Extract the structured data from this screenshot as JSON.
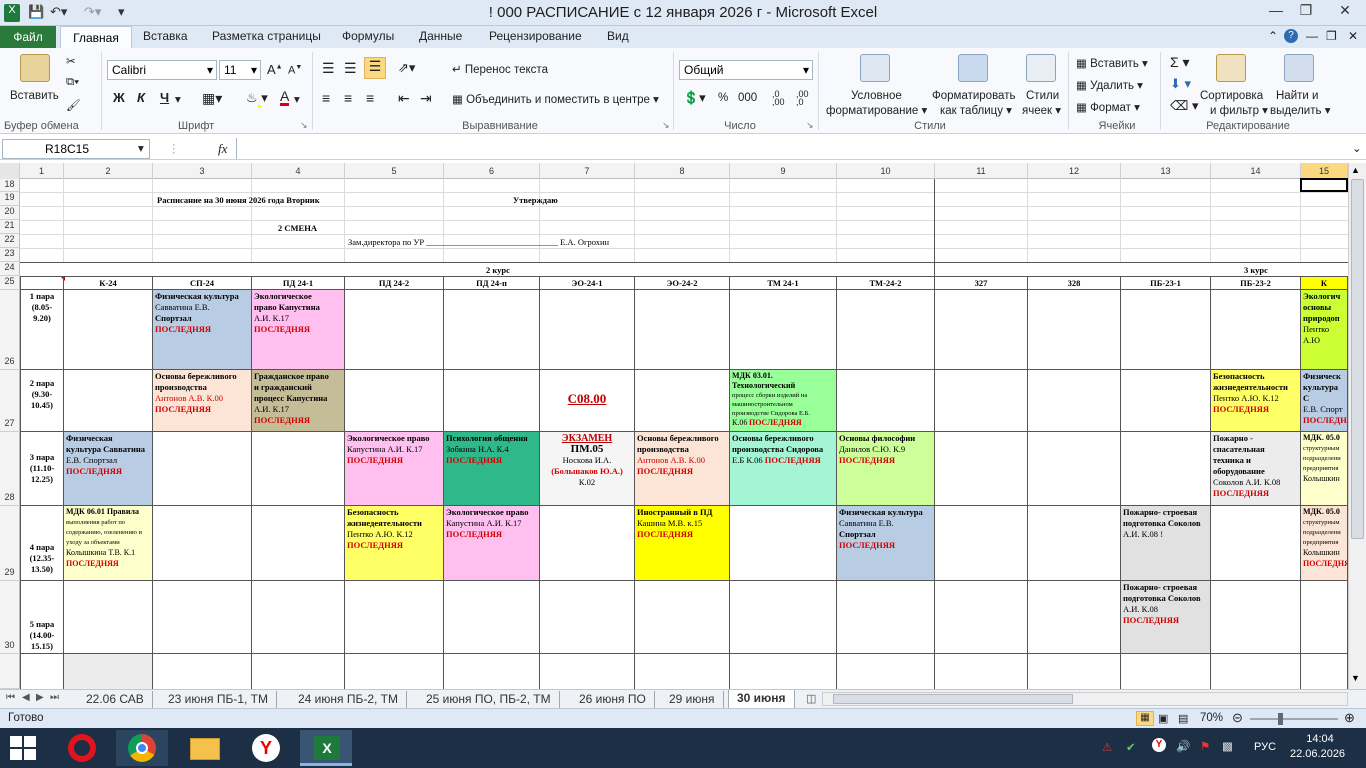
{
  "window": {
    "title": "! 000 РАСПИСАНИЕ с 12 января 2026 г  -  Microsoft Excel"
  },
  "tabs": [
    "Файл",
    "Главная",
    "Вставка",
    "Разметка страницы",
    "Формулы",
    "Данные",
    "Рецензирование",
    "Вид"
  ],
  "ribbon": {
    "clipboard": {
      "paste": "Вставить",
      "label": "Буфер обмена"
    },
    "font": {
      "name": "Calibri",
      "size": "11",
      "label": "Шрифт",
      "bold": "Ж",
      "italic": "К",
      "underline": "Ч"
    },
    "alignment": {
      "wrap": "Перенос текста",
      "merge": "Объединить и поместить в центре",
      "label": "Выравнивание"
    },
    "number": {
      "format": "Общий",
      "label": "Число"
    },
    "styles": {
      "cond": "Условное",
      "cond2": "форматирование",
      "table": "Форматировать",
      "table2": "как таблицу",
      "cell": "Стили",
      "cell2": "ячеек",
      "label": "Стили"
    },
    "cells": {
      "insert": "Вставить",
      "delete": "Удалить",
      "format": "Формат",
      "label": "Ячейки"
    },
    "editing": {
      "sort": "Сортировка",
      "sort2": "и фильтр",
      "find": "Найти и",
      "find2": "выделить",
      "label": "Редактирование"
    }
  },
  "formula": {
    "namebox": "R18C15",
    "fx": "fx",
    "content": ""
  },
  "columns": [
    "1",
    "2",
    "3",
    "4",
    "5",
    "6",
    "7",
    "8",
    "9",
    "10",
    "11",
    "12",
    "13",
    "14",
    "15"
  ],
  "rows": [
    "18",
    "19",
    "20",
    "21",
    "22",
    "23",
    "24",
    "25",
    "26",
    "27",
    "28",
    "29",
    "30"
  ],
  "sheet": {
    "heading": "Расписание на 30 июня 2026 года  Вторник",
    "approve": "Утверждаю",
    "shift": "2 СМЕНА",
    "deputy": "Зам.директора по УР  _______________________________  Е.А. Огрохин",
    "course2": "2 курс",
    "course3": "3 курс",
    "groups": [
      "К-24",
      "СП-24",
      "ПД 24-1",
      "ПД 24-2",
      "ПД 24-п",
      "ЭО-24-1",
      "ЭО-24-2",
      "ТМ 24-1",
      "ТМ-24-2",
      "327",
      "328",
      "ПБ-23-1",
      "ПБ-23-2",
      "К"
    ],
    "pairs": [
      {
        "n": "1 пара",
        "t": "(8.05-",
        "t2": "9.20)"
      },
      {
        "n": "2 пара",
        "t": "(9.30-",
        "t2": "10.45)"
      },
      {
        "n": "3 пара",
        "t": "(11.10-",
        "t2": "12.25)"
      },
      {
        "n": "4 пара",
        "t": "(12.35-",
        "t2": "13.50)"
      },
      {
        "n": "5 пара",
        "t": "(14.00-",
        "t2": "15.15)"
      }
    ],
    "last": "ПОСЛЕДНЯЯ",
    "cells": {
      "r1c3": {
        "a": "Физическая культура",
        "b": "Савватина Е.В.",
        "c": "Спортзал"
      },
      "r1c4": {
        "a": "Экологическое",
        "b": "право Капустина",
        "c": "А.И. К.17"
      },
      "r1c15": {
        "a": "Экологич",
        "b": "основы",
        "c": "природоп",
        "d": "Пентко А.Ю"
      },
      "r2c3": {
        "a": "Основы бережливого",
        "b": "производства",
        "c": "Антонов А.В. К.00"
      },
      "r2c4": {
        "a": "Гражданское право",
        "b": "и гражданский",
        "c": "процесс Капустина",
        "d": "А.И. К.17"
      },
      "r2c7": "С08.00",
      "r2c9": {
        "a": "МДК 03.01. Технологический",
        "b": "процесс сборки изделий на",
        "c": "машиностроительном",
        "d": "производстве Сидорова Е.Б.",
        "e": "К.06"
      },
      "r2c14": {
        "a": "Безопасность",
        "b": "жизнедеятельности",
        "c": "Пентко А.Ю. К.12"
      },
      "r2c15": {
        "a": "Физическ",
        "b": "культура С",
        "c": "Е.В. Спорт"
      },
      "r3c2": {
        "a": "Физическая",
        "b": "культура Савватина",
        "c": "Е.В. Спортзал"
      },
      "r3c5": {
        "a": "Экологическое право",
        "b": "Капустина А.И. К.17"
      },
      "r3c6": {
        "a": "Психология общения",
        "b": "Зобкина Н.А. К.4"
      },
      "r3c7": {
        "a": "ЭКЗАМЕН",
        "b": "ПМ.05",
        "c": "Носкова И.А.",
        "d": "(Большаков Ю.А.)",
        "e": "К.02"
      },
      "r3c8": {
        "a": "Основы бережливого",
        "b": "производства",
        "c": "Антонов А.В. К.00"
      },
      "r3c9": {
        "a": "Основы бережливого",
        "b": "производства Сидорова",
        "c": "Е.Б К.06"
      },
      "r3c10": {
        "a": "Основы философии",
        "b": "Данилов С.Ю. К.9"
      },
      "r3c14": {
        "a": "Пожарно -",
        "b": "спасательная",
        "c": "техника и",
        "d": "оборудование",
        "e": "Соколов А.И. К.08"
      },
      "r3c15": {
        "a": "МДК. 05.0",
        "b": "структурным",
        "c": "подразделени",
        "d": "предприятия",
        "e": "Колышкин"
      },
      "r4c2": {
        "a": "МДК 06.01 Правила",
        "b": "выполнения работ по",
        "c": "содержанию, озеленению и",
        "d": "уходу за объектами",
        "e": "Колышкина Т.В. К.1"
      },
      "r4c5": {
        "a": "Безопасность",
        "b": "жизнедеятельности",
        "c": "Пентко А.Ю. К.12"
      },
      "r4c6": {
        "a": "Экологическое право",
        "b": "Капустина А.И. К.17"
      },
      "r4c8": {
        "a": "Иностранный в ПД",
        "b": "Кашина М.В. к.15"
      },
      "r4c10": {
        "a": "Физическая культура",
        "b": "Савватина Е.В.",
        "c": "Спортзал"
      },
      "r4c13": {
        "a": "Пожарно- строевая",
        "b": "подготовка Соколов",
        "c": "А.И. К.08",
        "d": "!"
      },
      "r4c15": {
        "a": "МДК. 05.0",
        "b": "структурным",
        "c": "подразделени",
        "d": "предприятия",
        "e": "Колышкин"
      },
      "r5c13": {
        "a": "Пожарно- строевая",
        "b": "подготовка Соколов",
        "c": "А.И. К.08"
      }
    }
  },
  "sheet_tabs": [
    "22.06 САВ",
    "23 июня ПБ-1, ТМ",
    "24 июня ПБ-2, ТМ",
    "25 июня ПО, ПБ-2, ТМ",
    "26 июня ПО",
    "29 июня",
    "30 июня"
  ],
  "status": {
    "ready": "Готово",
    "zoom": "70%"
  },
  "tray": {
    "lang": "РУС",
    "time": "14:04",
    "date": "22.06.2026"
  },
  "colors": {
    "blue": "#b8cce4",
    "pink": "#ffc0f0",
    "peach": "#fce4d6",
    "olive": "#c4bd97",
    "green": "#99ff99",
    "yellow": "#ffff66",
    "teal": "#2fb88a",
    "mint": "#a3f5d5",
    "lime": "#ccff99",
    "gray": "#e1e1e1",
    "lightyellow": "#ffffcc",
    "aqua": "#00ff99"
  }
}
